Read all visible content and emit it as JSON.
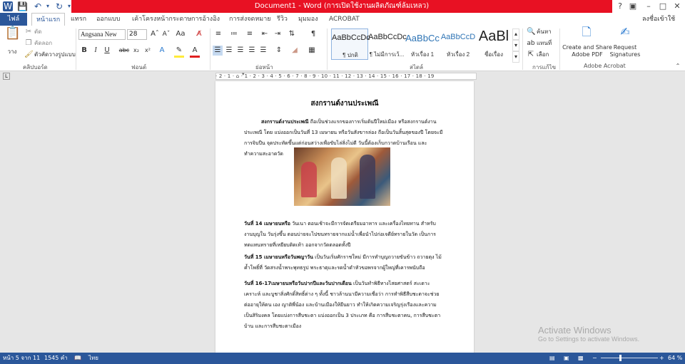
{
  "app": {
    "title": "Document1 -  Word (การเปิดใช้งานผลิตภัณฑ์ล้มเหลว)",
    "user": "ลงชื่อเข้าใช้"
  },
  "tabs": [
    "ไฟล์",
    "หน้าแรก",
    "แทรก",
    "ออกแบบ",
    "เค้าโครงหน้ากระดาษ",
    "การอ้างอิง",
    "การส่งจดหมาย",
    "รีวิว",
    "มุมมอง",
    "ACROBAT"
  ],
  "ribbon": {
    "clipboard": {
      "paste_label": "วาง",
      "cut_label": "ตัด",
      "copy_label": "คัดลอก",
      "format_painter_label": "ตัวคัดวางรูปแบบ",
      "group": "คลิปบอร์ด"
    },
    "font": {
      "font_name": "Angsana New",
      "font_size": "28",
      "group": "ฟอนต์"
    },
    "paragraph": {
      "group": "ย่อหน้า"
    },
    "styles": {
      "items": [
        {
          "sample": "AaBbCcDc",
          "name": "¶ ปกติ"
        },
        {
          "sample": "AaBbCcDc",
          "name": "¶ ไม่มีการเว้..."
        },
        {
          "sample": "AaBbCc",
          "name": "หัวเรื่อง 1"
        },
        {
          "sample": "AaBbCcD",
          "name": "หัวเรื่อง 2"
        },
        {
          "sample": "AaBl",
          "name": "ชื่อเรื่อง"
        }
      ],
      "group": "สไตล์"
    },
    "editing": {
      "find_label": "ค้นหา",
      "replace_label": "แทนที่",
      "select_label": "เลือก",
      "group": "การแก้ไข"
    },
    "acrobat": {
      "create_label": "Create and Share Adobe PDF",
      "request_label": "Request Signatures",
      "group": "Adobe Acrobat"
    }
  },
  "ruler": {
    "numbers": "· 2 · 1 · ⌂ · 1 · 2 · 3 · 4 · 5 · 6 · 7 · 8 · 9 · 10 · 11 · 12 · 13 · 14 · 15 · 16 · 17 · 18 · 19"
  },
  "document": {
    "title": "สงกรานต์งานประเพณี",
    "p1_bold": "สงกรานต์งานประเพณี",
    "p1_text": " ถือเป็นช่วงแรกของการเริ่มต้นปีใหม่เมือง หรือสงกรานต์งานประเพณี โดย แบ่งออกเป็นวันที่ 13 เมษายน  หรือวันสังขารล่อง ถือเป็นวันสิ้นสุดของปี โดยจะมีการจิบปืน จุดประทัดขึ้นแต่ก่อนสว่างเพื่อขับไล่สิ่งไม่ดี  วันนี้ต้องเก็บกวาดบ้านเรือน และ ทำความสะอาดวัด",
    "p2_bold": "วันที่ 14 เมษายนหรือ",
    "p2_text": " วันเนา  ตอนเช้าจะมีการจัดเตรียมอาหาร  และเครื่องไทยทาน  สำหรับงานบุญใน วันรุ่งขึ้น  ตอนบ่ายจะไปขนทรายจากแม่น้ำเพื่อนำไปก่อเจดีย์ทรายในวัด  เป็นการทดแทนทรายที่เหยียบติดเท้า ออกจากวัดตลอดทั้งปี",
    "p3_bold": "วันที่ 15 เมษายนหรือวันพญาวัน",
    "p3_text": " เป็นวันเริ่มศักราชใหม่ มีการทำบุญถวายขันข้าว ถวายตุง  ไม้ค้ำโพธิ์ที่ วัดสรงน้ำพระพุทธรูป พระธาตุและรดน้ำดำหัวขอพรจากผู้ใหญ่ที่เคารพนับถือ",
    "p4_bold": "วันที่ 16-17เมษายนหรือวันปากปีและวันปากเดือน",
    "p4_text": " เป็นวันทำพิธีทางไสยศาสตร์  สะเดาะ เคราะห์  และบูชาสิ่งศักดิ์สิทธิ์ต่าง ๆ ทั้งนี้ ชาวล้านนามีความเชื่อว่า การทำพิธีสืบชะตาจะช่วยต่ออายุให้ตน เอง ญาติพี่น้อง และบ้านเมืองให้ยืนยาว ทำให้เกิดความเจริญรุ่งเรืองและความเป็นสิริมงคล โดยแบ่งการสืบชะตา แบ่งออกเป็น 3 ประเภท คือ การสืบชะตาคน, การสืบชะตาบ้าน และการสืบชะตาเมือง"
  },
  "status": {
    "page": "หน้า 5 จาก 11",
    "words": "1545 คำ",
    "language": "ไทย",
    "zoom": "64 %"
  },
  "watermark": {
    "line1": "Activate Windows",
    "line2": "Go to Settings to activate Windows."
  },
  "colors": {
    "accent": "#2b579a",
    "titlebar_red": "#e81123"
  }
}
